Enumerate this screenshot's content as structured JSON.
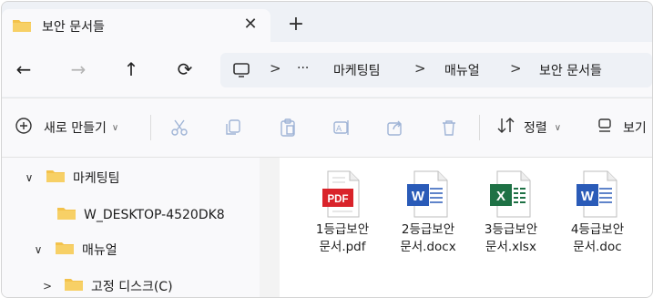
{
  "tab": {
    "title": "보안 문서들",
    "close_label": "✕",
    "new_tab_label": "+"
  },
  "nav": {
    "back_glyph": "←",
    "forward_glyph": "→",
    "up_glyph": "↑",
    "refresh_glyph": "⟳",
    "breadcrumb": [
      "···",
      "마케팅팀",
      "매뉴얼",
      "보안 문서들"
    ],
    "separator": ">"
  },
  "toolbar": {
    "new_label": "새로 만들기",
    "sort_label": "정렬",
    "view_label": "보기"
  },
  "tree": [
    {
      "label": "마케팅팀",
      "expander": "∨"
    },
    {
      "label": "W_DESKTOP-4520DK8",
      "expander": ""
    },
    {
      "label": "매뉴얼",
      "expander": "∨"
    },
    {
      "label": "고정 디스크(C)",
      "expander": ">"
    }
  ],
  "files": [
    {
      "line1": "1등급보안",
      "line2": "문서.pdf",
      "type": "pdf",
      "badge": "PDF",
      "color": "#d9232a"
    },
    {
      "line1": "2등급보안",
      "line2": "문서.docx",
      "type": "word",
      "badge": "W",
      "color": "#2a5bb8"
    },
    {
      "line1": "3등급보안",
      "line2": "문서.xlsx",
      "type": "excel",
      "badge": "X",
      "color": "#1e7145"
    },
    {
      "line1": "4등급보안",
      "line2": "문서.doc",
      "type": "word",
      "badge": "W",
      "color": "#2a5bb8"
    }
  ],
  "colors": {
    "folder": "#f3c24b",
    "accent": "#0f6cbd"
  }
}
